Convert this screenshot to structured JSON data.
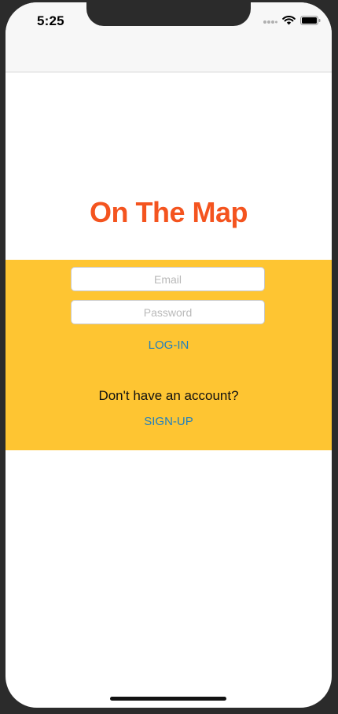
{
  "status_bar": {
    "time": "5:25",
    "icons": [
      "cellular-signal-icon",
      "wifi-icon",
      "battery-icon"
    ]
  },
  "app": {
    "title": "On The Map",
    "title_color": "#f4541f",
    "panel_color": "#fec532",
    "link_color": "#1f7fbf"
  },
  "login": {
    "email_placeholder": "Email",
    "email_value": "",
    "password_placeholder": "Password",
    "password_value": "",
    "login_label": "LOG-IN"
  },
  "signup": {
    "prompt": "Don't have an account?",
    "signup_label": "SIGN-UP"
  }
}
